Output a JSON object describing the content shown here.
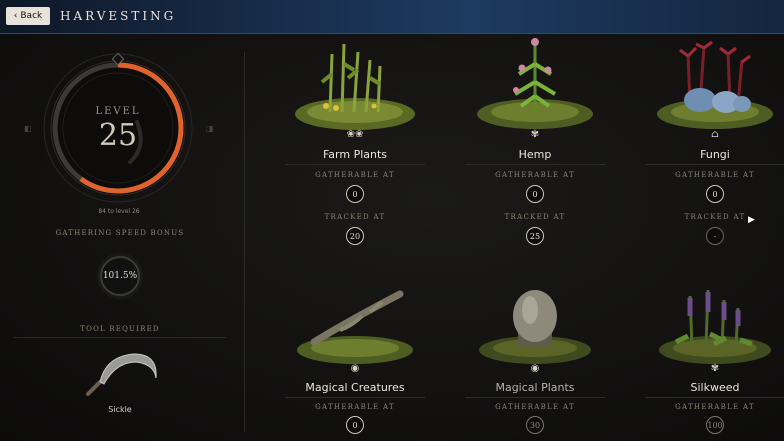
{
  "header": {
    "back_label": "Back",
    "title": "HARVESTING"
  },
  "level_panel": {
    "level_label": "LEVEL",
    "level_value": "25",
    "progress_text": "84 to level 26",
    "progress_fraction": 0.6,
    "bonus_label": "GATHERING SPEED BONUS",
    "bonus_value": "101.5%",
    "tool_label": "TOOL REQUIRED",
    "tool_name": "Sickle"
  },
  "cards": [
    {
      "name": "Farm Plants",
      "icon": "leaf-pair-icon",
      "gatherable_label": "GATHERABLE AT",
      "gatherable_value": "0",
      "tracked_label": "TRACKED AT",
      "tracked_value": "20"
    },
    {
      "name": "Hemp",
      "icon": "hemp-leaf-icon",
      "gatherable_label": "GATHERABLE AT",
      "gatherable_value": "0",
      "tracked_label": "TRACKED AT",
      "tracked_value": "25"
    },
    {
      "name": "Fungi",
      "icon": "mushroom-icon",
      "gatherable_label": "GATHERABLE AT",
      "gatherable_value": "0",
      "tracked_label": "TRACKED AT",
      "tracked_value": "-"
    },
    {
      "name": "Magical Creatures",
      "icon": "creature-icon",
      "gatherable_label": "GATHERABLE AT",
      "gatherable_value": "0"
    },
    {
      "name": "Magical Plants",
      "icon": "magic-plant-icon",
      "gatherable_label": "GATHERABLE AT",
      "gatherable_value": "30"
    },
    {
      "name": "Silkweed",
      "icon": "silkweed-icon",
      "gatherable_label": "GATHERABLE AT",
      "gatherable_value": "100"
    }
  ],
  "colors": {
    "progress_ring": "#e0622c",
    "header_bg": "#1d3a60",
    "background": "#121110"
  }
}
